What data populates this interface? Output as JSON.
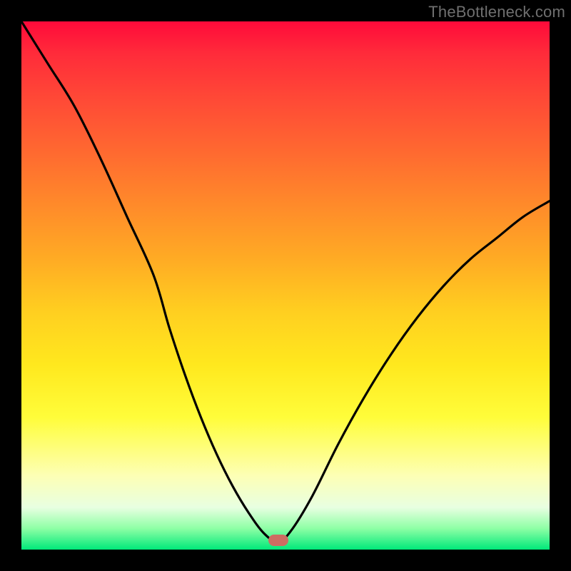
{
  "attribution": "TheBottleneck.com",
  "gradient_colors": {
    "top": "#ff0a3a",
    "mid_upper": "#ff8b2a",
    "mid": "#ffe81e",
    "mid_lower": "#fdffb5",
    "bottom": "#00e97a"
  },
  "marker": {
    "color": "#cd6d62",
    "x_fraction": 0.486,
    "y_fraction": 0.982
  },
  "chart_data": {
    "type": "line",
    "title": "",
    "xlabel": "",
    "ylabel": "",
    "xlim": [
      0,
      100
    ],
    "ylim": [
      0,
      100
    ],
    "series": [
      {
        "name": "bottleneck-curve",
        "x": [
          0,
          5,
          10,
          15,
          20,
          25,
          28,
          31,
          34,
          37,
          40,
          43,
          46,
          48.6,
          51,
          55,
          60,
          65,
          70,
          75,
          80,
          85,
          90,
          95,
          100
        ],
        "values": [
          100,
          92,
          84,
          74,
          63,
          52,
          42,
          33,
          25,
          18,
          12,
          7,
          3,
          1.5,
          3.5,
          10,
          20,
          29,
          37,
          44,
          50,
          55,
          59,
          63,
          66
        ]
      }
    ],
    "annotations": [
      {
        "text": "TheBottleneck.com",
        "position": "top-right"
      }
    ]
  }
}
